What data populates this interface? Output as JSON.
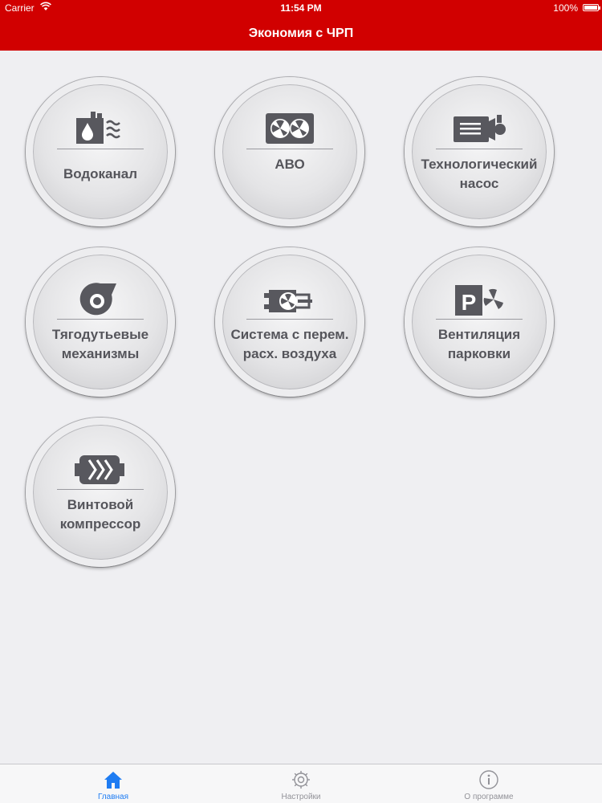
{
  "status_bar": {
    "carrier": "Carrier",
    "time": "11:54 PM",
    "battery": "100%"
  },
  "nav": {
    "title": "Экономия с ЧРП"
  },
  "tiles": [
    {
      "label": "Водоканал",
      "icon": "water-utility-icon"
    },
    {
      "label": "АВО",
      "icon": "air-cooler-icon"
    },
    {
      "label": "Технологический\nнасос",
      "icon": "process-pump-icon"
    },
    {
      "label": "Тягодутьевые\nмеханизмы",
      "icon": "draft-fan-icon"
    },
    {
      "label": "Система с перем.\nрасх. воздуха",
      "icon": "variable-air-system-icon"
    },
    {
      "label": "Вентиляция\nпарковки",
      "icon": "parking-ventilation-icon"
    },
    {
      "label": "Винтовой\nкомпрессор",
      "icon": "screw-compressor-icon"
    }
  ],
  "tabs": [
    {
      "label": "Главная",
      "icon": "home-icon",
      "active": true
    },
    {
      "label": "Настройки",
      "icon": "gear-icon",
      "active": false
    },
    {
      "label": "О программе",
      "icon": "info-icon",
      "active": false
    }
  ],
  "colors": {
    "brand_red": "#d10000",
    "tab_active": "#1e7cf2",
    "tab_inactive": "#929298",
    "icon_gray": "#58585e"
  }
}
